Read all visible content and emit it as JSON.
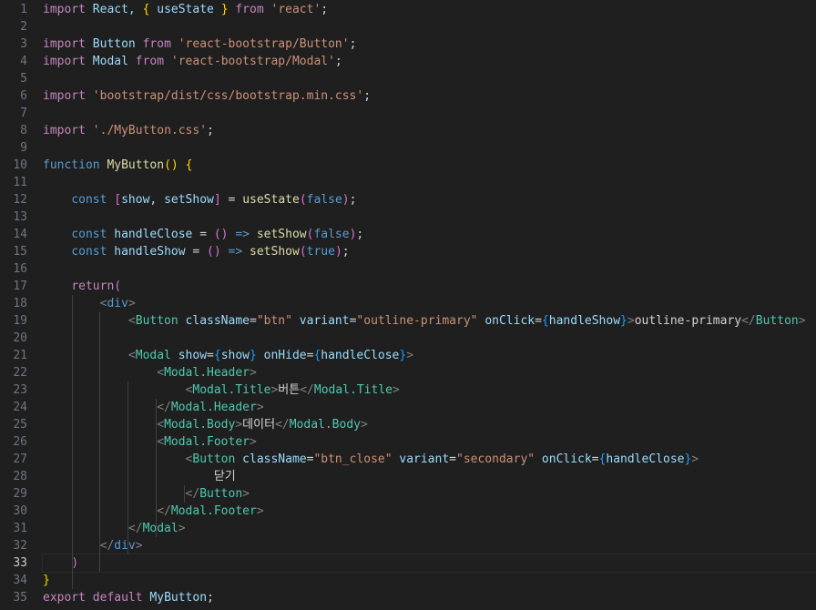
{
  "theme": {
    "background": "#1f1f1f",
    "line_number": "#6e7681",
    "line_number_active": "#cccccc",
    "keyword": "#c586c0",
    "storage": "#569cd6",
    "function": "#dcdcaa",
    "variable": "#9cdcfe",
    "string": "#ce9178",
    "tag": "#4ec9b0",
    "bracket_tag": "#808080",
    "plain": "#d4d4d4",
    "bracket1": "#ffd700",
    "bracket2": "#da70d6",
    "bracket3": "#179fff"
  },
  "editor": {
    "active_line": 33,
    "lines": [
      {
        "n": "1",
        "tokens": [
          [
            "import",
            "kw"
          ],
          [
            " React, ",
            "var"
          ],
          [
            "{",
            "b1"
          ],
          [
            " useState ",
            "var"
          ],
          [
            "}",
            "b1"
          ],
          [
            " from ",
            "kw"
          ],
          [
            "'react'",
            "str"
          ],
          [
            ";",
            "plain"
          ]
        ]
      },
      {
        "n": "2",
        "tokens": []
      },
      {
        "n": "3",
        "tokens": [
          [
            "import",
            "kw"
          ],
          [
            " Button ",
            "var"
          ],
          [
            "from",
            "kw"
          ],
          [
            " ",
            "plain"
          ],
          [
            "'react-bootstrap/Button'",
            "str"
          ],
          [
            ";",
            "plain"
          ]
        ]
      },
      {
        "n": "4",
        "tokens": [
          [
            "import",
            "kw"
          ],
          [
            " Modal ",
            "var"
          ],
          [
            "from",
            "kw"
          ],
          [
            " ",
            "plain"
          ],
          [
            "'react-bootstrap/Modal'",
            "str"
          ],
          [
            ";",
            "plain"
          ]
        ]
      },
      {
        "n": "5",
        "tokens": []
      },
      {
        "n": "6",
        "tokens": [
          [
            "import",
            "kw"
          ],
          [
            " ",
            "plain"
          ],
          [
            "'bootstrap/dist/css/bootstrap.min.css'",
            "str"
          ],
          [
            ";",
            "plain"
          ]
        ]
      },
      {
        "n": "7",
        "tokens": []
      },
      {
        "n": "8",
        "tokens": [
          [
            "import",
            "kw"
          ],
          [
            " ",
            "plain"
          ],
          [
            "'./MyButton.css'",
            "str"
          ],
          [
            ";",
            "plain"
          ]
        ]
      },
      {
        "n": "9",
        "tokens": []
      },
      {
        "n": "10",
        "tokens": [
          [
            "function",
            "st"
          ],
          [
            " ",
            "plain"
          ],
          [
            "MyButton",
            "fn"
          ],
          [
            "()",
            "b1"
          ],
          [
            " ",
            "plain"
          ],
          [
            "{",
            "b1"
          ]
        ]
      },
      {
        "n": "11",
        "tokens": []
      },
      {
        "n": "12",
        "tokens": [
          [
            "    ",
            "plain"
          ],
          [
            "const",
            "st"
          ],
          [
            " ",
            "plain"
          ],
          [
            "[",
            "b2"
          ],
          [
            "show",
            "var"
          ],
          [
            ", ",
            "plain"
          ],
          [
            "setShow",
            "var"
          ],
          [
            "]",
            "b2"
          ],
          [
            " = ",
            "plain"
          ],
          [
            "useState",
            "fn"
          ],
          [
            "(",
            "b2"
          ],
          [
            "false",
            "st"
          ],
          [
            ")",
            "b2"
          ],
          [
            ";",
            "plain"
          ]
        ]
      },
      {
        "n": "13",
        "tokens": []
      },
      {
        "n": "14",
        "tokens": [
          [
            "    ",
            "plain"
          ],
          [
            "const",
            "st"
          ],
          [
            " ",
            "plain"
          ],
          [
            "handleClose",
            "var"
          ],
          [
            " = ",
            "plain"
          ],
          [
            "()",
            "b2"
          ],
          [
            " ",
            "plain"
          ],
          [
            "=>",
            "st"
          ],
          [
            " ",
            "plain"
          ],
          [
            "setShow",
            "fn"
          ],
          [
            "(",
            "b2"
          ],
          [
            "false",
            "st"
          ],
          [
            ")",
            "b2"
          ],
          [
            ";",
            "plain"
          ]
        ]
      },
      {
        "n": "15",
        "tokens": [
          [
            "    ",
            "plain"
          ],
          [
            "const",
            "st"
          ],
          [
            " ",
            "plain"
          ],
          [
            "handleShow",
            "var"
          ],
          [
            " = ",
            "plain"
          ],
          [
            "()",
            "b2"
          ],
          [
            " ",
            "plain"
          ],
          [
            "=>",
            "st"
          ],
          [
            " ",
            "plain"
          ],
          [
            "setShow",
            "fn"
          ],
          [
            "(",
            "b2"
          ],
          [
            "true",
            "st"
          ],
          [
            ")",
            "b2"
          ],
          [
            ";",
            "plain"
          ]
        ]
      },
      {
        "n": "16",
        "tokens": []
      },
      {
        "n": "17",
        "tokens": [
          [
            "    ",
            "plain"
          ],
          [
            "return",
            "kw"
          ],
          [
            "(",
            "b2"
          ]
        ]
      },
      {
        "n": "18",
        "tokens": [
          [
            "        ",
            "plain"
          ],
          [
            "<",
            "tb"
          ],
          [
            "div",
            "st"
          ],
          [
            ">",
            "tb"
          ]
        ]
      },
      {
        "n": "19",
        "tokens": [
          [
            "            ",
            "plain"
          ],
          [
            "<",
            "tb"
          ],
          [
            "Button",
            "tag"
          ],
          [
            " ",
            "plain"
          ],
          [
            "className",
            "var"
          ],
          [
            "=",
            "plain"
          ],
          [
            "\"btn\"",
            "str"
          ],
          [
            " ",
            "plain"
          ],
          [
            "variant",
            "var"
          ],
          [
            "=",
            "plain"
          ],
          [
            "\"outline-primary\"",
            "str"
          ],
          [
            " ",
            "plain"
          ],
          [
            "onClick",
            "var"
          ],
          [
            "=",
            "plain"
          ],
          [
            "{",
            "b3"
          ],
          [
            "handleShow",
            "var"
          ],
          [
            "}",
            "b3"
          ],
          [
            ">",
            "tb"
          ],
          [
            "outline-primary",
            "plain"
          ],
          [
            "</",
            "tb"
          ],
          [
            "Button",
            "tag"
          ],
          [
            ">",
            "tb"
          ]
        ]
      },
      {
        "n": "20",
        "tokens": []
      },
      {
        "n": "21",
        "tokens": [
          [
            "            ",
            "plain"
          ],
          [
            "<",
            "tb"
          ],
          [
            "Modal",
            "tag"
          ],
          [
            " ",
            "plain"
          ],
          [
            "show",
            "var"
          ],
          [
            "=",
            "plain"
          ],
          [
            "{",
            "b3"
          ],
          [
            "show",
            "var"
          ],
          [
            "}",
            "b3"
          ],
          [
            " ",
            "plain"
          ],
          [
            "onHide",
            "var"
          ],
          [
            "=",
            "plain"
          ],
          [
            "{",
            "b3"
          ],
          [
            "handleClose",
            "var"
          ],
          [
            "}",
            "b3"
          ],
          [
            ">",
            "tb"
          ]
        ]
      },
      {
        "n": "22",
        "tokens": [
          [
            "                ",
            "plain"
          ],
          [
            "<",
            "tb"
          ],
          [
            "Modal.Header",
            "tag"
          ],
          [
            ">",
            "tb"
          ]
        ]
      },
      {
        "n": "23",
        "tokens": [
          [
            "                    ",
            "plain"
          ],
          [
            "<",
            "tb"
          ],
          [
            "Modal.Title",
            "tag"
          ],
          [
            ">",
            "tb"
          ],
          [
            "버튼",
            "plain"
          ],
          [
            "</",
            "tb"
          ],
          [
            "Modal.Title",
            "tag"
          ],
          [
            ">",
            "tb"
          ]
        ]
      },
      {
        "n": "24",
        "tokens": [
          [
            "                ",
            "plain"
          ],
          [
            "</",
            "tb"
          ],
          [
            "Modal.Header",
            "tag"
          ],
          [
            ">",
            "tb"
          ]
        ]
      },
      {
        "n": "25",
        "tokens": [
          [
            "                ",
            "plain"
          ],
          [
            "<",
            "tb"
          ],
          [
            "Modal.Body",
            "tag"
          ],
          [
            ">",
            "tb"
          ],
          [
            "데이터",
            "plain"
          ],
          [
            "</",
            "tb"
          ],
          [
            "Modal.Body",
            "tag"
          ],
          [
            ">",
            "tb"
          ]
        ]
      },
      {
        "n": "26",
        "tokens": [
          [
            "                ",
            "plain"
          ],
          [
            "<",
            "tb"
          ],
          [
            "Modal.Footer",
            "tag"
          ],
          [
            ">",
            "tb"
          ]
        ]
      },
      {
        "n": "27",
        "tokens": [
          [
            "                    ",
            "plain"
          ],
          [
            "<",
            "tb"
          ],
          [
            "Button",
            "tag"
          ],
          [
            " ",
            "plain"
          ],
          [
            "className",
            "var"
          ],
          [
            "=",
            "plain"
          ],
          [
            "\"btn_close\"",
            "str"
          ],
          [
            " ",
            "plain"
          ],
          [
            "variant",
            "var"
          ],
          [
            "=",
            "plain"
          ],
          [
            "\"secondary\"",
            "str"
          ],
          [
            " ",
            "plain"
          ],
          [
            "onClick",
            "var"
          ],
          [
            "=",
            "plain"
          ],
          [
            "{",
            "b3"
          ],
          [
            "handleClose",
            "var"
          ],
          [
            "}",
            "b3"
          ],
          [
            ">",
            "tb"
          ]
        ]
      },
      {
        "n": "28",
        "tokens": [
          [
            "                        ",
            "plain"
          ],
          [
            "닫기",
            "plain"
          ]
        ]
      },
      {
        "n": "29",
        "tokens": [
          [
            "                    ",
            "plain"
          ],
          [
            "</",
            "tb"
          ],
          [
            "Button",
            "tag"
          ],
          [
            ">",
            "tb"
          ]
        ]
      },
      {
        "n": "30",
        "tokens": [
          [
            "                ",
            "plain"
          ],
          [
            "</",
            "tb"
          ],
          [
            "Modal.Footer",
            "tag"
          ],
          [
            ">",
            "tb"
          ]
        ]
      },
      {
        "n": "31",
        "tokens": [
          [
            "            ",
            "plain"
          ],
          [
            "</",
            "tb"
          ],
          [
            "Modal",
            "tag"
          ],
          [
            ">",
            "tb"
          ]
        ]
      },
      {
        "n": "32",
        "tokens": [
          [
            "        ",
            "plain"
          ],
          [
            "</",
            "tb"
          ],
          [
            "div",
            "st"
          ],
          [
            ">",
            "tb"
          ]
        ]
      },
      {
        "n": "33",
        "tokens": [
          [
            "    ",
            "plain"
          ],
          [
            ")",
            "b2"
          ]
        ]
      },
      {
        "n": "34",
        "tokens": [
          [
            "}",
            "b1"
          ]
        ]
      },
      {
        "n": "35",
        "tokens": [
          [
            "export",
            "kw"
          ],
          [
            " ",
            "plain"
          ],
          [
            "default",
            "kw"
          ],
          [
            " ",
            "plain"
          ],
          [
            "MyButton",
            "var"
          ],
          [
            ";",
            "plain"
          ]
        ]
      }
    ]
  }
}
